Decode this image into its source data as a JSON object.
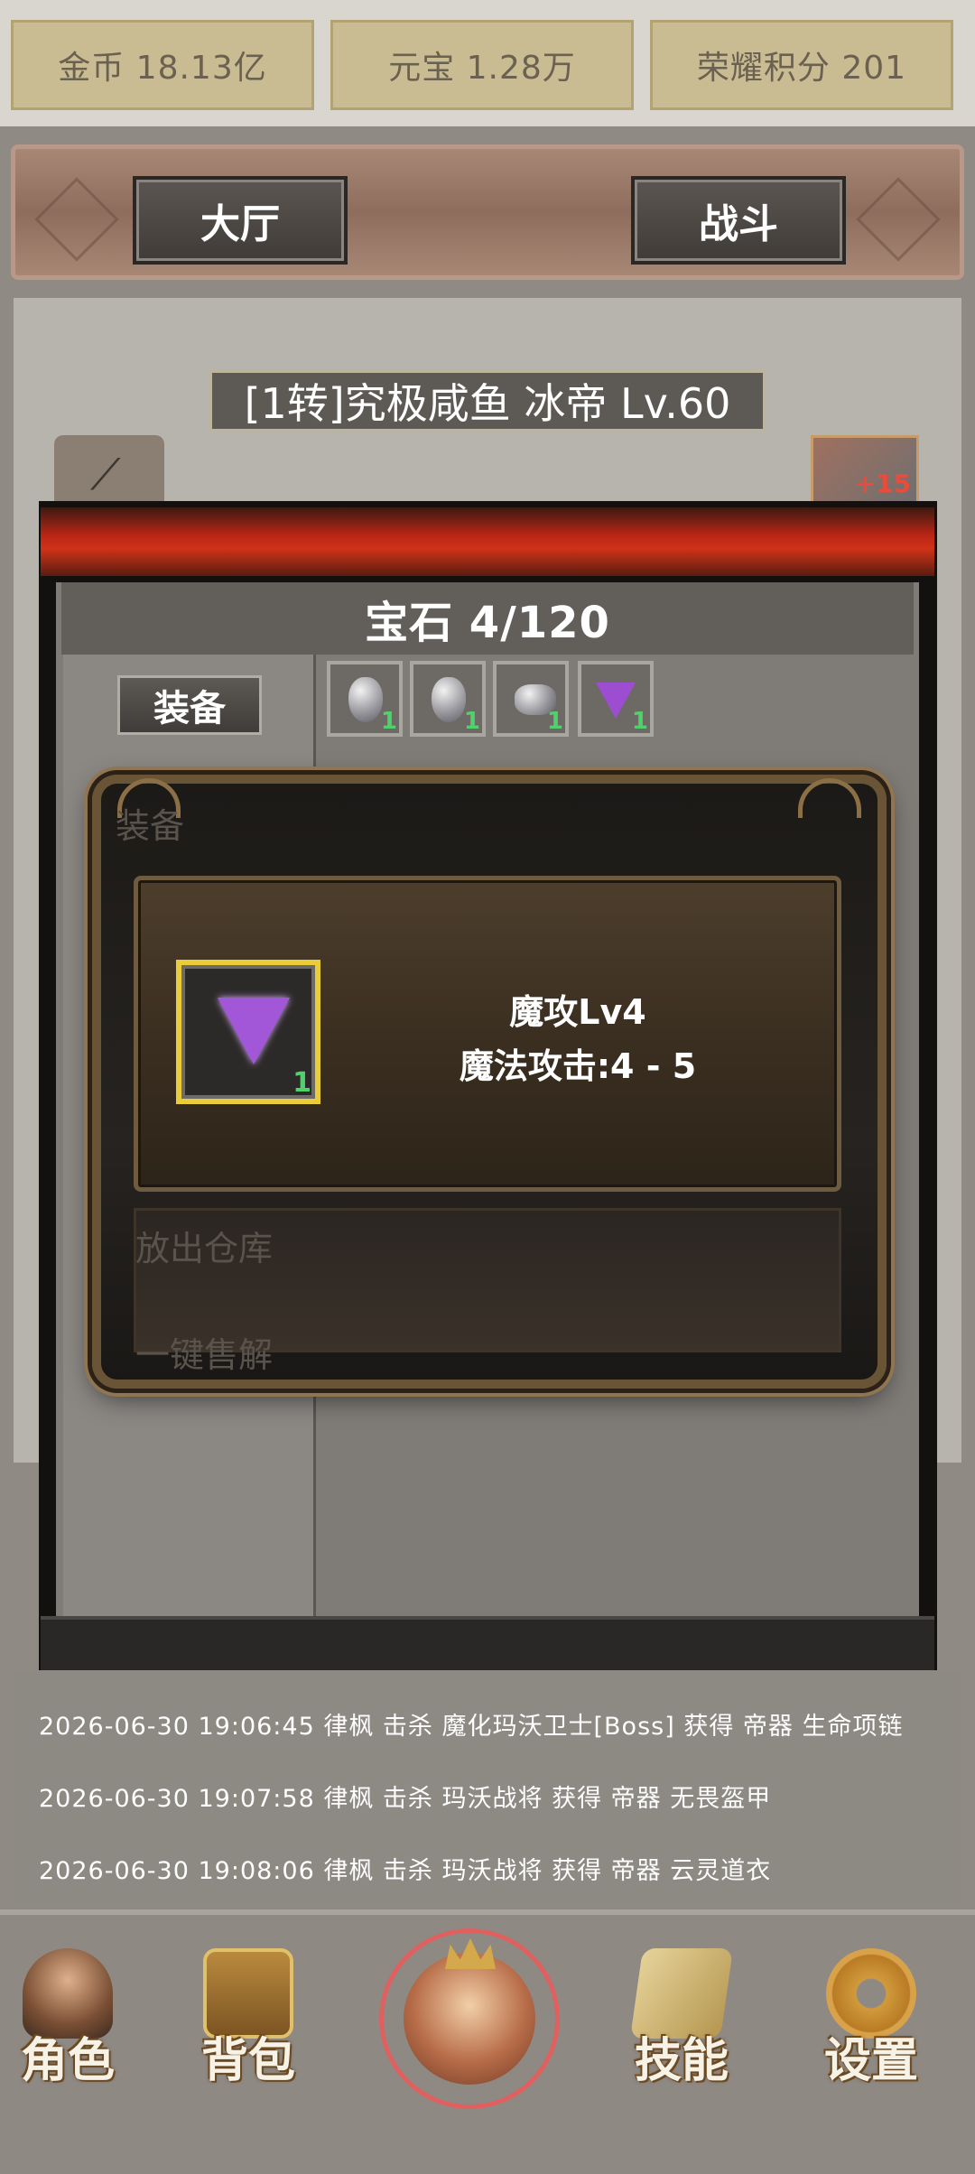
{
  "currencies": [
    {
      "label": "金币 18.13亿"
    },
    {
      "label": "元宝 1.28万"
    },
    {
      "label": "荣耀积分 201"
    }
  ],
  "tabs": {
    "lobby": "大厅",
    "battle": "战斗"
  },
  "character": {
    "title": "[1转]究极咸鱼 冰帝 Lv.60",
    "item_badge": "+15"
  },
  "gem_window": {
    "title": "宝石 4/120",
    "equip_button": "装备",
    "slots": [
      {
        "icon": "silver-gem-icon",
        "count": "1"
      },
      {
        "icon": "silver-gem-icon",
        "count": "1"
      },
      {
        "icon": "rough-stone-icon",
        "count": "1"
      },
      {
        "icon": "purple-gem-icon",
        "count": "1"
      }
    ],
    "background_buttons": {
      "move_to_storage": "放出仓库",
      "bulk_sell": "一键售解"
    }
  },
  "modal": {
    "gem_icon": "purple-gem-icon",
    "count": "1",
    "name": "魔攻Lv4",
    "attribute": "魔法攻击:4 - 5",
    "ghost_text": "装备"
  },
  "logs": [
    "2026-06-30 19:06:45 律枫 击杀 魔化玛沃卫士[Boss] 获得 帝器 生命项链",
    "2026-06-30 19:07:58 律枫 击杀 玛沃战将 获得 帝器 无畏盔甲",
    "2026-06-30 19:08:06 律枫 击杀 玛沃战将 获得 帝器 云灵道衣"
  ],
  "nav": {
    "character": "角色",
    "backpack": "背包",
    "skills": "技能",
    "settings": "设置"
  },
  "colors": {
    "accent_red": "#d03218",
    "gold_border": "#e8cc3a",
    "count_green": "#4fd16b",
    "gem_purple": "#a256d8"
  }
}
